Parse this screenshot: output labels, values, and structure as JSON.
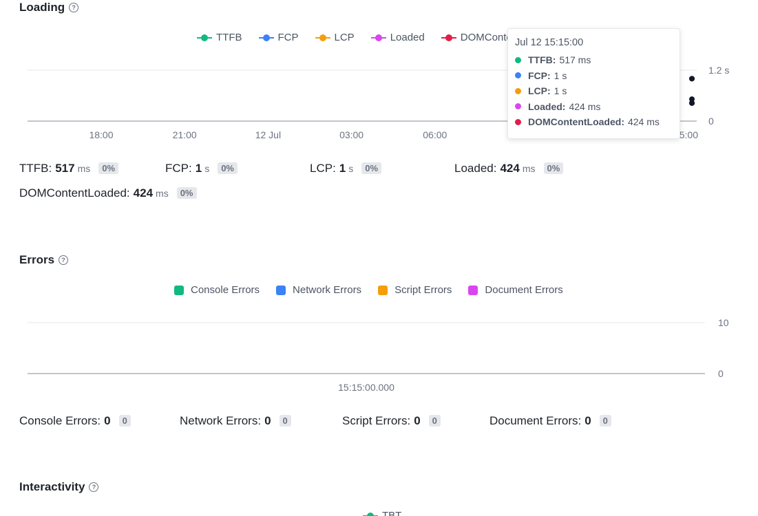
{
  "loading": {
    "title": "Loading",
    "help_icon": "?",
    "legend": [
      {
        "label": "TTFB",
        "color": "#10b981"
      },
      {
        "label": "FCP",
        "color": "#3b82f6"
      },
      {
        "label": "LCP",
        "color": "#f59e0b"
      },
      {
        "label": "Loaded",
        "color": "#d946ef"
      },
      {
        "label": "DOMContentLoaded",
        "color": "#e11d48"
      }
    ],
    "stats": [
      {
        "name": "TTFB:",
        "value": "517",
        "unit": "ms",
        "badge": "0%"
      },
      {
        "name": "FCP:",
        "value": "1",
        "unit": "s",
        "badge": "0%"
      },
      {
        "name": "LCP:",
        "value": "1",
        "unit": "s",
        "badge": "0%"
      },
      {
        "name": "Loaded:",
        "value": "424",
        "unit": "ms",
        "badge": "0%"
      },
      {
        "name": "DOMContentLoaded:",
        "value": "424",
        "unit": "ms",
        "badge": "0%"
      }
    ],
    "tooltip": {
      "title": "Jul 12 15:15:00",
      "rows": [
        {
          "name": "TTFB:",
          "value": "517 ms",
          "color": "#10b981"
        },
        {
          "name": "FCP:",
          "value": "1 s",
          "color": "#3b82f6"
        },
        {
          "name": "LCP:",
          "value": "1 s",
          "color": "#f59e0b"
        },
        {
          "name": "Loaded:",
          "value": "424 ms",
          "color": "#d946ef"
        },
        {
          "name": "DOMContentLoaded:",
          "value": "424 ms",
          "color": "#e11d48"
        }
      ]
    }
  },
  "errors": {
    "title": "Errors",
    "help_icon": "?",
    "legend": [
      {
        "label": "Console Errors",
        "color": "#10b981"
      },
      {
        "label": "Network Errors",
        "color": "#3b82f6"
      },
      {
        "label": "Script Errors",
        "color": "#f59e0b"
      },
      {
        "label": "Document Errors",
        "color": "#d946ef"
      }
    ],
    "stats": [
      {
        "name": "Console Errors:",
        "value": "0",
        "badge": "0"
      },
      {
        "name": "Network Errors:",
        "value": "0",
        "badge": "0"
      },
      {
        "name": "Script Errors:",
        "value": "0",
        "badge": "0"
      },
      {
        "name": "Document Errors:",
        "value": "0",
        "badge": "0"
      }
    ]
  },
  "interactivity": {
    "title": "Interactivity",
    "help_icon": "?",
    "legend_partial": "TBT"
  },
  "chart_data": [
    {
      "type": "line",
      "x_tick_labels": [
        "18:00",
        "21:00",
        "12 Jul",
        "03:00",
        "06:00",
        "0",
        "5:00"
      ],
      "y_tick_labels": [
        "1.2 s",
        "0"
      ],
      "ylim": [
        0,
        1.2
      ],
      "y_unit": "s",
      "series": [
        {
          "name": "TTFB",
          "color": "#10b981",
          "x": [
            "Jul 12 15:15:00"
          ],
          "values": [
            0.517
          ]
        },
        {
          "name": "FCP",
          "color": "#3b82f6",
          "x": [
            "Jul 12 15:15:00"
          ],
          "values": [
            1
          ]
        },
        {
          "name": "LCP",
          "color": "#f59e0b",
          "x": [
            "Jul 12 15:15:00"
          ],
          "values": [
            1
          ]
        },
        {
          "name": "Loaded",
          "color": "#d946ef",
          "x": [
            "Jul 12 15:15:00"
          ],
          "values": [
            0.424
          ]
        },
        {
          "name": "DOMContentLoaded",
          "color": "#e11d48",
          "x": [
            "Jul 12 15:15:00"
          ],
          "values": [
            0.424
          ]
        }
      ],
      "legend_position": "top",
      "grid": true
    },
    {
      "type": "bar",
      "categories": [
        "15:15:00.000"
      ],
      "y_tick_labels": [
        "10",
        "0"
      ],
      "ylim": [
        0,
        10
      ],
      "series": [
        {
          "name": "Console Errors",
          "color": "#10b981",
          "values": [
            0
          ]
        },
        {
          "name": "Network Errors",
          "color": "#3b82f6",
          "values": [
            0
          ]
        },
        {
          "name": "Script Errors",
          "color": "#f59e0b",
          "values": [
            0
          ]
        },
        {
          "name": "Document Errors",
          "color": "#d946ef",
          "values": [
            0
          ]
        }
      ],
      "legend_position": "top",
      "grid": true
    }
  ]
}
